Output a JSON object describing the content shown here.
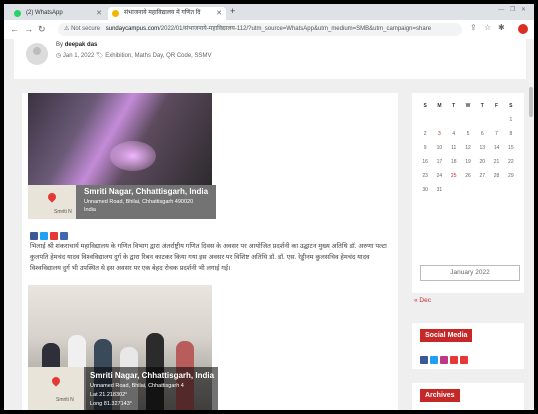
{
  "browser": {
    "tabs": [
      {
        "label": "(2) WhatsApp",
        "color": "#25d366"
      },
      {
        "label": "संभाजनाये महाविद्यालय में गणित दि",
        "color": "#f4b400"
      }
    ],
    "new_tab": "+",
    "window_controls": "— ❐ ✕",
    "url_security": "Not secure",
    "url_domain": "sundaycampus.com",
    "url_path": "/2022/01/संभाजनाये-महाविद्यालय-112/?utm_source=WhatsApp&utm_medium=SMB&utm_campaign=share"
  },
  "post": {
    "by_label": "By",
    "author": "deepak das",
    "date": "Jan 1, 2022",
    "tags": "Exhibition, Maths Day, QR Code, SSMV"
  },
  "gps1": {
    "title": "Smriti Nagar, Chhattisgarh, India",
    "line1": "Unnamed Road, Bhilai, Chhattisgarh 490020",
    "line2": "India",
    "map_label": "Smriti N"
  },
  "article_text": "भिलाई श्री शंकराचार्य महाविद्यालय के गणित विभाग द्वारा अंतर्राष्ट्रीय गणित दिवस के अवसर पर आयोजित प्रदर्शनी का उद्घाटन मुख्य अतिथि डॉ. अरुणा पल्टा कुलपति हेमचंद यादव विश्वविद्यालय दुर्ग के द्वारा रिबन काटकर किया गया इस अवसर पर विशिष्ट अतिथि डॉ. डॉ. एस. रेड्डीनम कुलसचिव हेमचंद यादव विश्वविद्यालय दुर्ग भी उपस्थित थे इस अवसर पर एक बेहद रोचक प्रदर्शनी भी लगाई गई।",
  "gps2": {
    "title": "Smriti Nagar, Chhattisgarh, India",
    "line1": "Unnamed Road, Bhilai, Chhattisgarh 4",
    "line2": "Lat 21.218302°",
    "line3": "Long 81.327143°",
    "map_label": "Smriti N"
  },
  "calendar": {
    "headers": [
      "S",
      "M",
      "T",
      "W",
      "T",
      "F",
      "S"
    ],
    "rows": [
      [
        "",
        "",
        "",
        "",
        "",
        "",
        "1"
      ],
      [
        "2",
        "3",
        "4",
        "5",
        "6",
        "7",
        "8"
      ],
      [
        "9",
        "10",
        "11",
        "12",
        "13",
        "14",
        "15"
      ],
      [
        "16",
        "17",
        "18",
        "19",
        "20",
        "21",
        "22"
      ],
      [
        "23",
        "24",
        "25",
        "26",
        "27",
        "28",
        "29"
      ],
      [
        "30",
        "31",
        "",
        "",
        "",
        "",
        ""
      ]
    ],
    "month_label": "January 2022",
    "prev_link": "« Dec"
  },
  "widgets": {
    "social_title": "Social Media",
    "archives_title": "Archives"
  },
  "colors": {
    "accent": "#c62828",
    "facebook": "#3b5998",
    "twitter": "#1da1f2",
    "youtube": "#e53935",
    "instagram": "#c13584"
  }
}
